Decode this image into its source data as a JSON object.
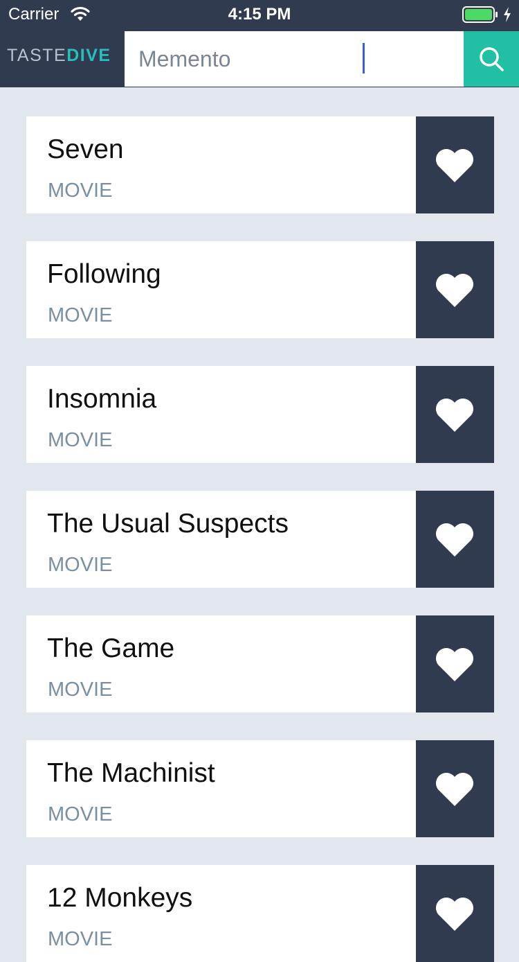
{
  "status_bar": {
    "carrier": "Carrier",
    "time": "4:15 PM",
    "wifi_icon": "wifi-icon",
    "battery_icon": "battery-icon",
    "battery_color": "#4cd964"
  },
  "header": {
    "logo_part1": "TASTE",
    "logo_part2": "DIVE",
    "search_value": "Memento",
    "search_icon": "search-icon",
    "colors": {
      "background": "#313b4f",
      "search_button": "#21bfa3",
      "logo_accent": "#27bfbd"
    }
  },
  "results": [
    {
      "title": "Seven",
      "type": "MOVIE"
    },
    {
      "title": "Following",
      "type": "MOVIE"
    },
    {
      "title": "Insomnia",
      "type": "MOVIE"
    },
    {
      "title": "The Usual Suspects",
      "type": "MOVIE"
    },
    {
      "title": "The Game",
      "type": "MOVIE"
    },
    {
      "title": "The Machinist",
      "type": "MOVIE"
    },
    {
      "title": "12 Monkeys",
      "type": "MOVIE"
    }
  ],
  "like_icon": "heart-icon",
  "colors": {
    "page_background": "#e2e7ee",
    "like_button": "#313b4f",
    "type_text": "#7a8fa1"
  }
}
